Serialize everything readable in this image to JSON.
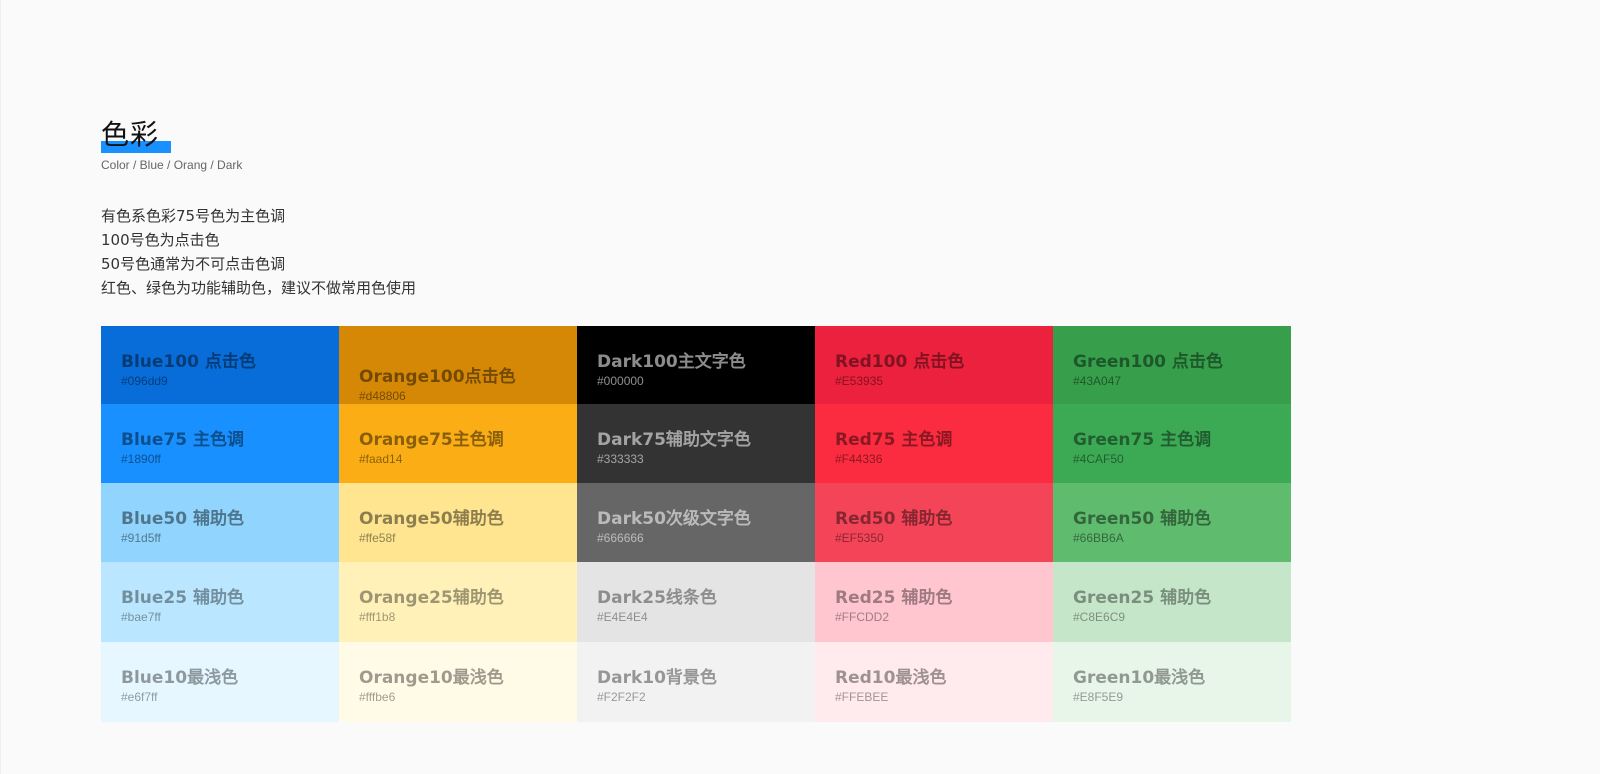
{
  "header": {
    "title": "色彩",
    "subtitle": "Color / Blue / Orang / Dark",
    "accent_color": "#1890ff"
  },
  "description": [
    "有色系色彩75号色为主色调",
    "100号色为点击色",
    "50号色通常为不可点击色调",
    "红色、绿色为功能辅助色，建议不做常用色使用"
  ],
  "palette": [
    [
      {
        "name": "Blue100 点击色",
        "hex": "#096dd9",
        "color": "#096dd9"
      },
      {
        "name": "Orange100点击色",
        "hex": "#d48806",
        "color": "#d48806"
      },
      {
        "name": "Dark100主文字色",
        "hex": "#000000",
        "color": "#000000"
      },
      {
        "name": "Red100 点击色",
        "hex": "#E53935",
        "color": "#ec213d"
      },
      {
        "name": "Green100 点击色",
        "hex": "#43A047",
        "color": "#379e4b"
      }
    ],
    [
      {
        "name": "Blue75 主色调",
        "hex": "#1890ff",
        "color": "#1890ff"
      },
      {
        "name": "Orange75主色调",
        "hex": "#faad14",
        "color": "#faad14"
      },
      {
        "name": "Dark75辅助文字色",
        "hex": "#333333",
        "color": "#333333"
      },
      {
        "name": "Red75 主色调",
        "hex": "#F44336",
        "color": "#fb2c3f"
      },
      {
        "name": "Green75 主色调",
        "hex": "#4CAF50",
        "color": "#3caa54"
      }
    ],
    [
      {
        "name": "Blue50 辅助色",
        "hex": "#91d5ff",
        "color": "#91d5ff"
      },
      {
        "name": "Orange50辅助色",
        "hex": "#ffe58f",
        "color": "#ffe58f"
      },
      {
        "name": "Dark50次级文字色",
        "hex": "#666666",
        "color": "#666666"
      },
      {
        "name": "Red50 辅助色",
        "hex": "#EF5350",
        "color": "#f44558"
      },
      {
        "name": "Green50 辅助色",
        "hex": "#66BB6A",
        "color": "#5fbb6d"
      }
    ],
    [
      {
        "name": "Blue25 辅助色",
        "hex": "#bae7ff",
        "color": "#bae7ff"
      },
      {
        "name": "Orange25辅助色",
        "hex": "#fff1b8",
        "color": "#fff1b8"
      },
      {
        "name": "Dark25线条色",
        "hex": "#E4E4E4",
        "color": "#e4e4e4"
      },
      {
        "name": "Red25 辅助色",
        "hex": "#FFCDD2",
        "color": "#ffc6d0"
      },
      {
        "name": "Green25 辅助色",
        "hex": "#C8E6C9",
        "color": "#c6e6ca"
      }
    ],
    [
      {
        "name": "Blue10最浅色",
        "hex": "#e6f7ff",
        "color": "#e6f7ff"
      },
      {
        "name": "Orange10最浅色",
        "hex": "#fffbe6",
        "color": "#fffbe6"
      },
      {
        "name": "Dark10背景色",
        "hex": "#F2F2F2",
        "color": "#f2f2f2"
      },
      {
        "name": "Red10最浅色",
        "hex": "#FFEBEE",
        "color": "#ffebee"
      },
      {
        "name": "Green10最浅色",
        "hex": "#E8F5E9",
        "color": "#e8f5e9"
      }
    ]
  ]
}
